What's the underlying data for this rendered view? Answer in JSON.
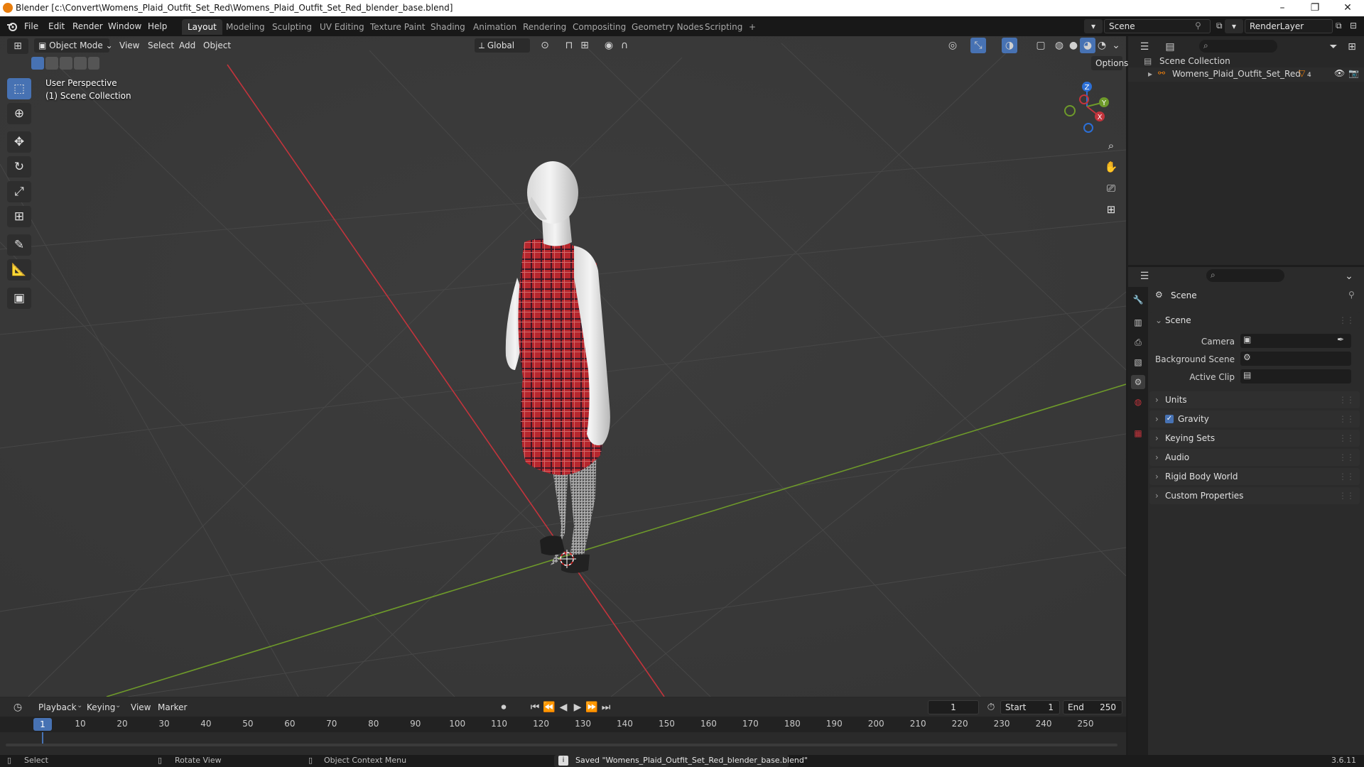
{
  "window": {
    "title": "Blender [c:\\Convert\\Womens_Plaid_Outfit_Set_Red\\Womens_Plaid_Outfit_Set_Red_blender_base.blend]",
    "controls": [
      "–",
      "❐",
      "✕"
    ]
  },
  "menu": {
    "items": [
      "File",
      "Edit",
      "Render",
      "Window",
      "Help"
    ]
  },
  "workspaces": {
    "tabs": [
      "Layout",
      "Modeling",
      "Sculpting",
      "UV Editing",
      "Texture Paint",
      "Shading",
      "Animation",
      "Rendering",
      "Compositing",
      "Geometry Nodes",
      "Scripting"
    ],
    "active": "Layout",
    "add": "+"
  },
  "scene_selector": {
    "scene": "Scene",
    "render_layer": "RenderLayer"
  },
  "viewport": {
    "mode": "Object Mode",
    "menus": [
      "View",
      "Select",
      "Add",
      "Object"
    ],
    "transform_orientation": "Global",
    "options_label": "Options",
    "overlay_title": "User Perspective",
    "overlay_subtitle": "(1) Scene Collection",
    "gizmo_axes": {
      "x": "X",
      "y": "Y",
      "z": "Z"
    }
  },
  "outliner": {
    "root": "Scene Collection",
    "items": [
      {
        "name": "Womens_Plaid_Outfit_Set_Red",
        "badge": "4"
      }
    ]
  },
  "properties": {
    "header": "Scene",
    "section_scene": "Scene",
    "fields": [
      {
        "label": "Camera"
      },
      {
        "label": "Background Scene"
      },
      {
        "label": "Active Clip"
      }
    ],
    "panels": [
      {
        "label": "Units",
        "checkbox": false
      },
      {
        "label": "Gravity",
        "checkbox": true
      },
      {
        "label": "Keying Sets",
        "checkbox": false
      },
      {
        "label": "Audio",
        "checkbox": false
      },
      {
        "label": "Rigid Body World",
        "checkbox": false
      },
      {
        "label": "Custom Properties",
        "checkbox": false
      }
    ]
  },
  "timeline": {
    "menus": [
      "Playback",
      "Keying",
      "View",
      "Marker"
    ],
    "current_frame": "1",
    "start_label": "Start",
    "start_value": "1",
    "end_label": "End",
    "end_value": "250",
    "ticks": [
      "1",
      "10",
      "20",
      "30",
      "40",
      "50",
      "60",
      "70",
      "80",
      "90",
      "100",
      "110",
      "120",
      "130",
      "140",
      "150",
      "160",
      "170",
      "180",
      "190",
      "200",
      "210",
      "220",
      "230",
      "240",
      "250"
    ]
  },
  "statusbar": {
    "select": "Select",
    "rotate": "Rotate View",
    "context": "Object Context Menu",
    "message": "Saved \"Womens_Plaid_Outfit_Set_Red_blender_base.blend\"",
    "version": "3.6.11"
  },
  "colors": {
    "accent": "#4772b3",
    "x_axis": "#c3343c",
    "y_axis": "#6e9a2a",
    "plaid_red": "#b6262d",
    "blender_orange": "#e87d0d"
  }
}
